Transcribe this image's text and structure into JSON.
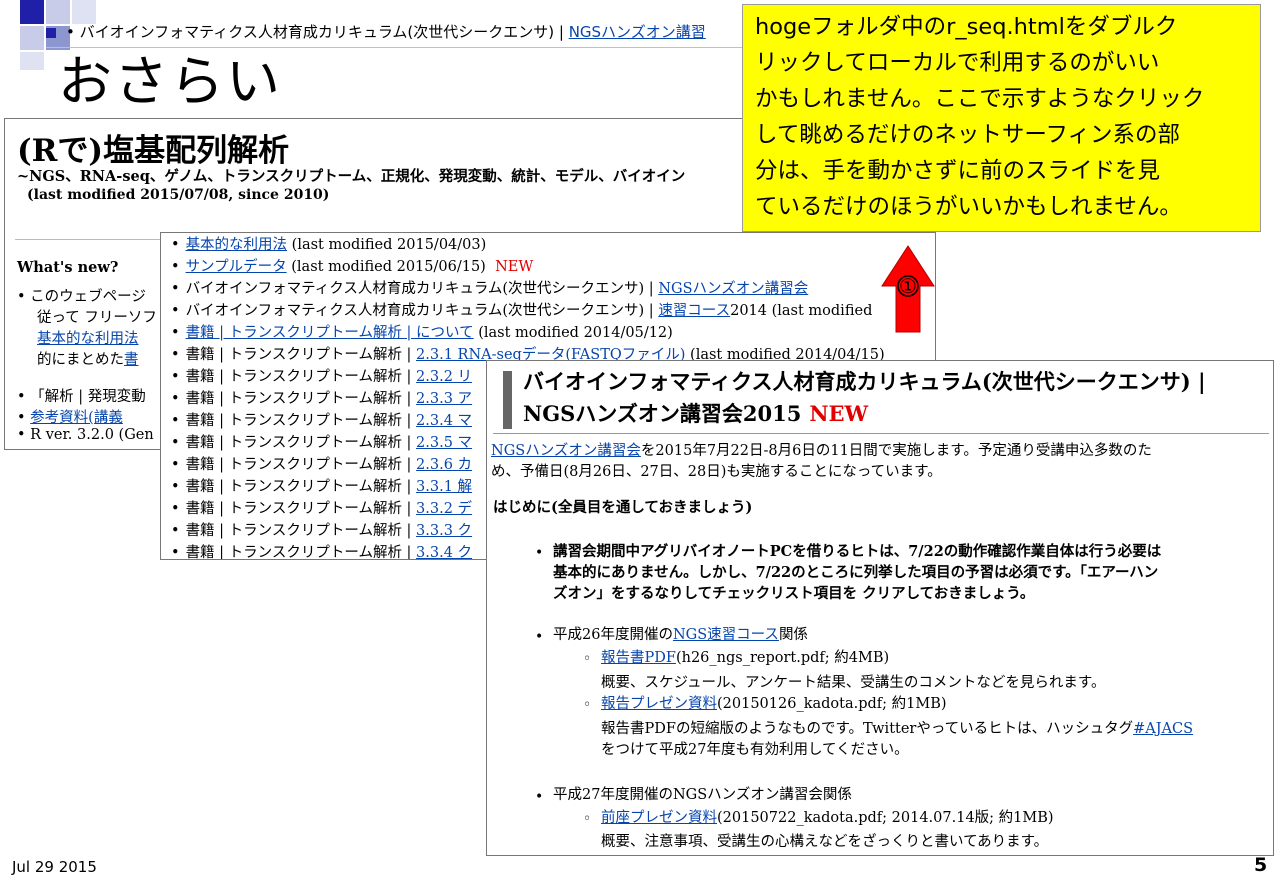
{
  "slide": {
    "breadcrumb_prefix": "バイオインフォマティクス人材育成カリキュラム(次世代シークエンサ) | ",
    "breadcrumb_link": "NGSハンズオン講習",
    "title": "おさらい",
    "date": "Jul 29 2015",
    "page_number": "5"
  },
  "callout": {
    "lines": [
      "hogeフォルダ中のr_seq.htmlをダブルク",
      "リックしてローカルで利用するのがいい",
      "かもしれません。ここで示すようなクリック",
      "して眺めるだけのネットサーフィン系の部",
      "分は、手を動かさずに前のスライドを見",
      "ているだけのほうがいいかもしれません。"
    ],
    "background": "#ffff00"
  },
  "step_marker": "①",
  "main_page": {
    "title": "(Rで)塩基配列解析",
    "subtitle": "~NGS、RNA-seq、ゲノム、トランスクリプトーム、正規化、発現変動、統計、モデル、バイオイン",
    "modified": "(last modified 2015/07/08, since 2010)",
    "whats_new": "What's new?",
    "lines": [
      {
        "t1": "このウェブページ",
        "link": ""
      },
      {
        "t1": "従って フリーソフ",
        "link": ""
      },
      {
        "t1": "",
        "link": "基本的な利用法"
      },
      {
        "t1": "的にまとめた",
        "link": "書"
      },
      {
        "t1": "「解析 | 発現変動",
        "link": ""
      },
      {
        "t1": "",
        "link": "参考資料(講義"
      },
      {
        "t1": "R ver. 3.2.0 (Gen",
        "link": ""
      }
    ]
  },
  "list_panel": {
    "rows": [
      {
        "pre": "",
        "link": "基本的な利用法",
        "post": " (last modified 2015/04/03)",
        "new": ""
      },
      {
        "pre": "",
        "link": "サンプルデータ",
        "post": " (last modified 2015/06/15)",
        "new": "NEW"
      },
      {
        "pre": "バイオインフォマティクス人材育成カリキュラム(次世代シークエンサ) | ",
        "link": "NGSハンズオン講習会",
        "post": "",
        "new": ""
      },
      {
        "pre": "バイオインフォマティクス人材育成カリキュラム(次世代シークエンサ) | ",
        "link": "速習コース",
        "post": "2014 (last modified",
        "new": ""
      },
      {
        "pre": "",
        "link": "書籍 | トランスクリプトーム解析 | について",
        "post": " (last modified 2014/05/12)",
        "new": ""
      },
      {
        "pre": "書籍 | トランスクリプトーム解析 | ",
        "link": "2.3.1 RNA-seqデータ(FASTQファイル)",
        "post": " (last modified 2014/04/15)",
        "new": ""
      },
      {
        "pre": "書籍 | トランスクリプトーム解析 | ",
        "link": "2.3.2 リ",
        "post": "",
        "new": ""
      },
      {
        "pre": "書籍 | トランスクリプトーム解析 | ",
        "link": "2.3.3 ア",
        "post": "",
        "new": ""
      },
      {
        "pre": "書籍 | トランスクリプトーム解析 | ",
        "link": "2.3.4 マ",
        "post": "",
        "new": ""
      },
      {
        "pre": "書籍 | トランスクリプトーム解析 | ",
        "link": "2.3.5 マ",
        "post": "",
        "new": ""
      },
      {
        "pre": "書籍 | トランスクリプトーム解析 | ",
        "link": "2.3.6 カ",
        "post": "",
        "new": ""
      },
      {
        "pre": "書籍 | トランスクリプトーム解析 | ",
        "link": "3.3.1 解",
        "post": "",
        "new": ""
      },
      {
        "pre": "書籍 | トランスクリプトーム解析 | ",
        "link": "3.3.2 デ",
        "post": "",
        "new": ""
      },
      {
        "pre": "書籍 | トランスクリプトーム解析 | ",
        "link": "3.3.3 ク",
        "post": "",
        "new": ""
      },
      {
        "pre": "書籍 | トランスクリプトーム解析 | ",
        "link": "3.3.4 ク",
        "post": "",
        "new": ""
      }
    ]
  },
  "detail_panel": {
    "heading_line1": "バイオインフォマティクス人材育成カリキュラム(次世代シークエンサ) |",
    "heading_line2": "NGSハンズオン講習会2015",
    "heading_new": "NEW",
    "intro_link": "NGSハンズオン講習会",
    "intro_line1": "を2015年7月22日-8月6日の11日間で実施します。予定通り受講申込多数のた",
    "intro_line2": "め、予備日(8月26日、27日、28日)も実施することになっています。",
    "hajimeni": "はじめに(全員目を通しておきましょう)",
    "notice_line1": "講習会期間中アグリバイオノートPCを借りるヒトは、7/22の動作確認作業自体は行う必要は",
    "notice_line2": "基本的にありません。しかし、7/22のところに列挙した項目の予習は必須です。「エアーハン",
    "notice_line3": "ズオン」をするなりしてチェックリスト項目を クリアしておきましょう。",
    "h26_pre": "平成26年度開催の",
    "h26_link": "NGS速習コース",
    "h26_post": "関係",
    "report_link": "報告書PDF",
    "report_info": "(h26_ngs_report.pdf; 約4MB)",
    "report_desc": "概要、スケジュール、アンケート結果、受講生のコメントなどを見られます。",
    "present_link": "報告プレゼン資料",
    "present_info": "(20150126_kadota.pdf; 約1MB)",
    "present_desc1_pre": "報告書PDFの短縮版のようなものです。Twitterやっているヒトは、ハッシュタグ",
    "present_desc1_link": "#AJACS",
    "present_desc2": "をつけて平成27年度も有効利用してください。",
    "h27_text": "平成27年度開催のNGSハンズオン講習会関係",
    "zenza_link": "前座プレゼン資料",
    "zenza_info": "(20150722_kadota.pdf; 2014.07.14版; 約1MB)",
    "zenza_desc": "概要、注意事項、受講生の心構えなどをざっくりと書いてあります。"
  },
  "colors": {
    "link": "#0645ad",
    "new": "#e00000",
    "arrow": "#ff0000"
  }
}
